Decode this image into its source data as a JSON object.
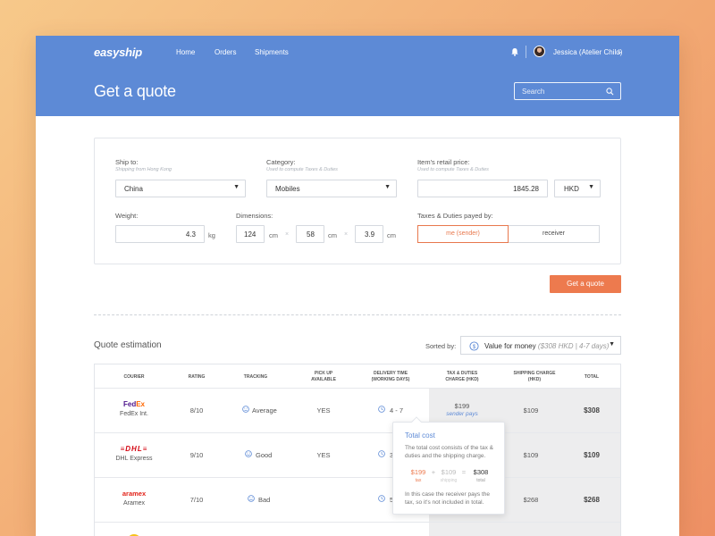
{
  "header": {
    "logo": "easyship",
    "nav": [
      "Home",
      "Orders",
      "Shipments"
    ],
    "user_name": "Jessica (Atelier Child)",
    "page_title": "Get a quote",
    "search_placeholder": "Search"
  },
  "form": {
    "ship_to": {
      "label": "Ship to:",
      "sub": "Shipping from Hong Kong",
      "value": "China"
    },
    "category": {
      "label": "Category:",
      "sub": "Used to compute Taxes & Duties",
      "value": "Mobiles"
    },
    "price": {
      "label": "Item's retail price:",
      "sub": "Used to compute Taxes & Duties",
      "value": "1845.28",
      "currency": "HKD"
    },
    "weight": {
      "label": "Weight:",
      "value": "4.3",
      "unit": "kg"
    },
    "dimensions": {
      "label": "Dimensions:",
      "length": "124",
      "width": "58",
      "height": "3.9",
      "unit": "cm",
      "times": "×"
    },
    "taxes": {
      "label": "Taxes & Duties payed by:",
      "options": [
        "me (sender)",
        "receiver"
      ],
      "selected": "me (sender)"
    },
    "submit": "Get a quote"
  },
  "quotes": {
    "title": "Quote estimation",
    "sort_label": "Sorted by:",
    "sort_value": "Value for money",
    "sort_detail": "($308 HKD | 4-7 days)",
    "columns": [
      "COURIER",
      "RATING",
      "TRACKING",
      "PICK UP AVAILABLE",
      "DELIVERY TIME (WORKING DAYS)",
      "TAX & DUTIES CHARGE (HKD)",
      "SHIPPING CHARGE (HKD)",
      "TOTAL"
    ],
    "rows": [
      {
        "logo": "FedEx",
        "name": "FedEx Int.",
        "rating": "8/10",
        "tracking": "Average",
        "pickup": "YES",
        "delivery": "4 - 7",
        "tax": "$199",
        "tax_note": "sender pays",
        "shipping": "$109",
        "total": "$308"
      },
      {
        "logo": "DHL",
        "name": "DHL Express",
        "rating": "9/10",
        "tracking": "Good",
        "pickup": "YES",
        "delivery": "3",
        "tax": "",
        "tax_note": "",
        "shipping": "$109",
        "total": "$109"
      },
      {
        "logo": "aramex",
        "name": "Aramex",
        "rating": "7/10",
        "tracking": "Bad",
        "pickup": "",
        "delivery": "5",
        "tax": "",
        "tax_note": "",
        "shipping": "$268",
        "total": "$268"
      }
    ]
  },
  "popover": {
    "title": "Total cost",
    "desc": "The total cost consists of the tax & duties and the shipping charge.",
    "tax": "$199",
    "tax_label": "tax",
    "plus": "+",
    "shipping": "$109",
    "shipping_label": "shipping",
    "equals": "=",
    "total": "$308",
    "total_label": "total",
    "note": "In this case the receiver pays the tax, so it's not included in total."
  },
  "colors": {
    "primary": "#5d8ad6",
    "accent": "#ed7a4e",
    "fedex_purple": "#4d148c",
    "fedex_orange": "#ff6600",
    "dhl_red": "#d40511",
    "aramex_red": "#e2231a"
  }
}
